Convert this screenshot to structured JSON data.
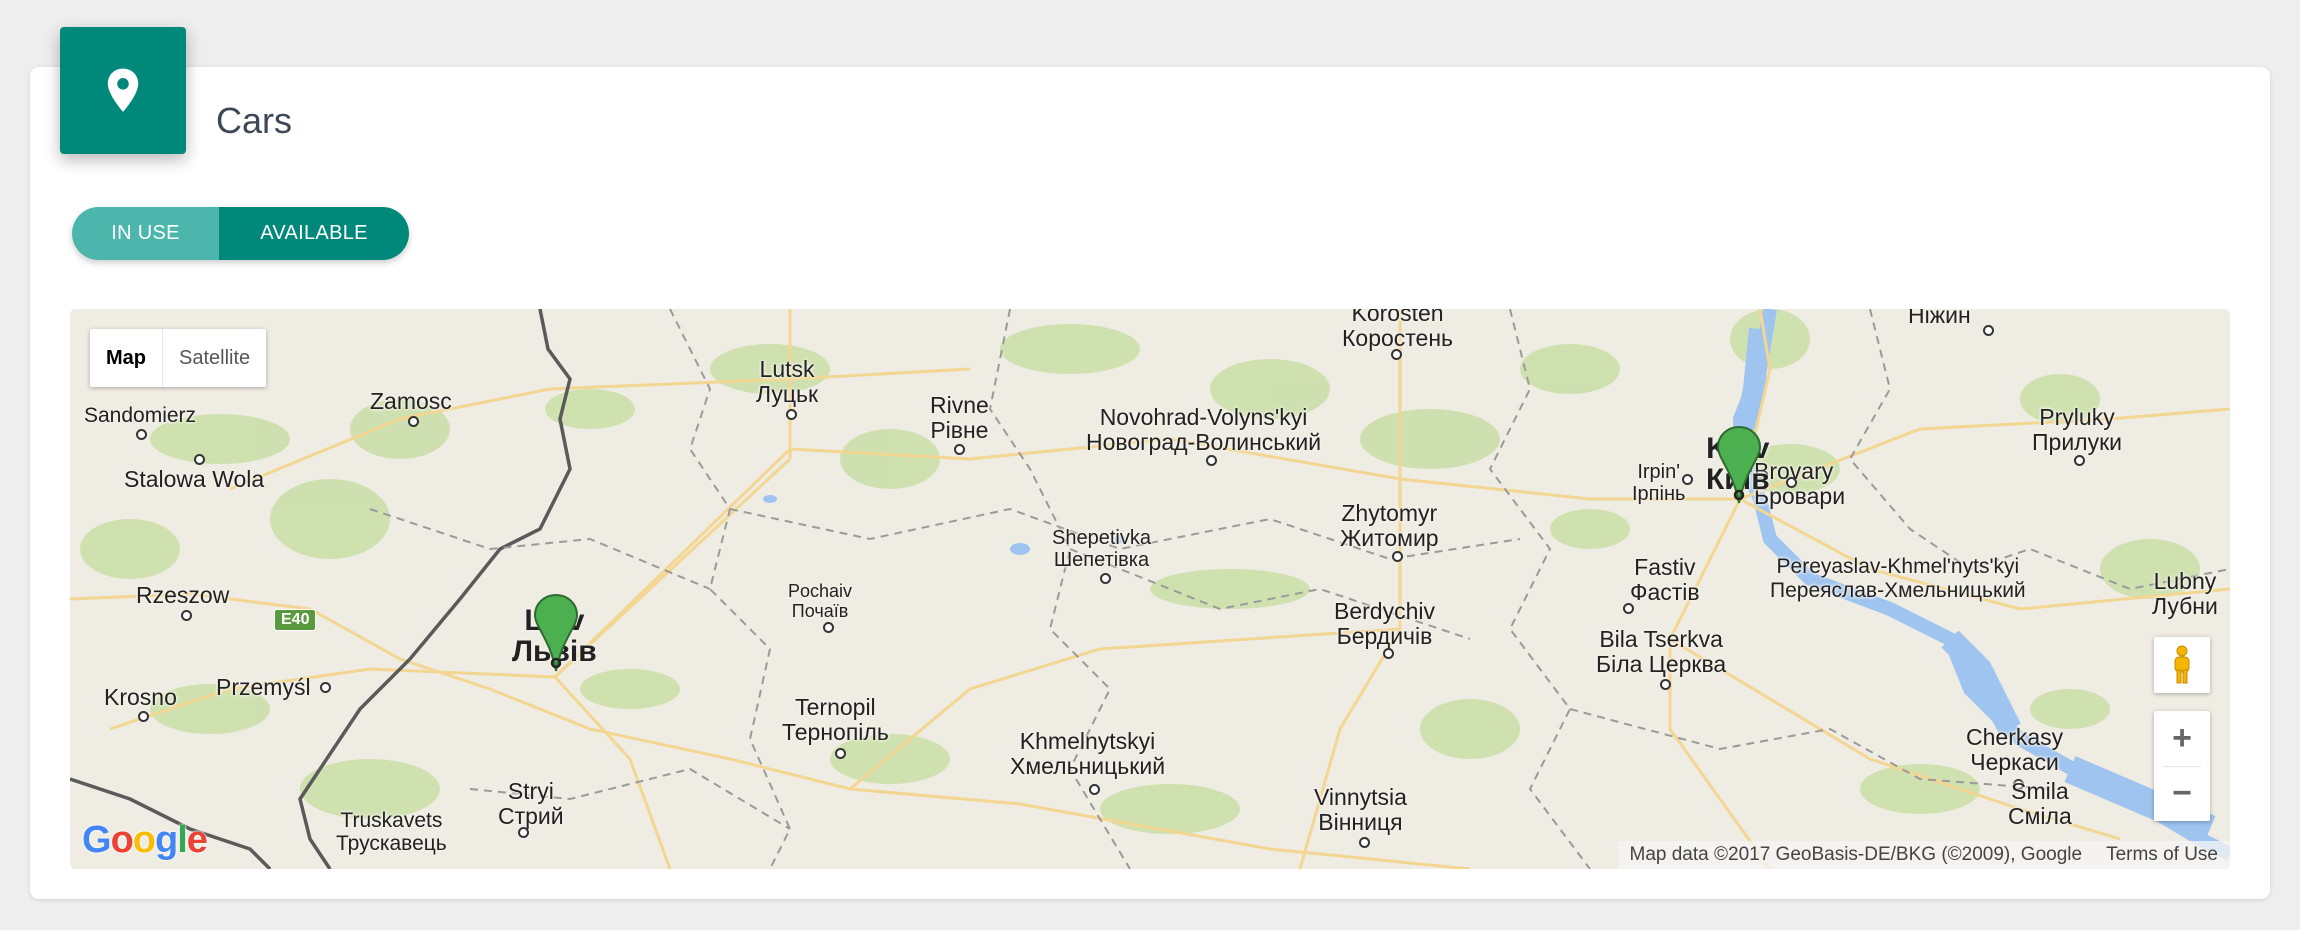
{
  "card": {
    "title": "Cars",
    "icon": "map-pin-icon",
    "accent_color": "#00897b"
  },
  "toggle": {
    "in_use_label": "IN USE",
    "available_label": "AVAILABLE",
    "selected": "AVAILABLE"
  },
  "map": {
    "type_control": {
      "map_label": "Map",
      "satellite_label": "Satellite",
      "active": "Map"
    },
    "places": [
      {
        "line1": "Korosten",
        "line2": "Коростень"
      },
      {
        "line1": "Ніжин",
        "line2": ""
      },
      {
        "line1": "Lutsk",
        "line2": "Луцьк"
      },
      {
        "line1": "Zamosc",
        "line2": ""
      },
      {
        "line1": "Sandomierz",
        "line2": ""
      },
      {
        "line1": "Stalowa Wola",
        "line2": ""
      },
      {
        "line1": "Rivne",
        "line2": "Рівне"
      },
      {
        "line1": "Novohrad-Volyns'kyi",
        "line2": "Новоград-Волинський"
      },
      {
        "line1": "Pryluky",
        "line2": "Прилуки"
      },
      {
        "line1": "Irpin'",
        "line2": "Ірпінь"
      },
      {
        "line1": "Brovary",
        "line2": "Бровари"
      },
      {
        "line1": "Zhytomyr",
        "line2": "Житомир"
      },
      {
        "line1": "Shepetivka",
        "line2": "Шепетівка"
      },
      {
        "line1": "Rzeszow",
        "line2": ""
      },
      {
        "line1": "Pochaiv",
        "line2": "Почаїв"
      },
      {
        "line1": "Fastiv",
        "line2": "Фастів"
      },
      {
        "line1": "Pereyaslav-Khmel'nyts'kyi",
        "line2": "Переяслав-Хмельницький"
      },
      {
        "line1": "Lubny",
        "line2": "Лубни"
      },
      {
        "line1": "Berdychiv",
        "line2": "Бердичів"
      },
      {
        "line1": "Bila Tserkva",
        "line2": "Біла Церква"
      },
      {
        "line1": "Krosno",
        "line2": ""
      },
      {
        "line1": "Przemyśl",
        "line2": ""
      },
      {
        "line1": "Ternopil",
        "line2": "Тернопіль"
      },
      {
        "line1": "Khmelnytskyi",
        "line2": "Хмельницький"
      },
      {
        "line1": "Cherkasy",
        "line2": "Черкаси"
      },
      {
        "line1": "Stryi",
        "line2": "Стрий"
      },
      {
        "line1": "Truskavets",
        "line2": "Трускавець"
      },
      {
        "line1": "Vinnytsia",
        "line2": "Вінниця"
      },
      {
        "line1": "Smila",
        "line2": "Сміла"
      }
    ],
    "major_cities": [
      {
        "line1": "Lviv",
        "line2": "Львів"
      },
      {
        "line1": "Kyiv",
        "line2": "Київ"
      }
    ],
    "road_shield": "E40",
    "markers": [
      {
        "name": "marker-lviv",
        "color": "#4caf50"
      },
      {
        "name": "marker-kyiv",
        "color": "#4caf50"
      }
    ],
    "logo": "Google",
    "attribution": "Map data ©2017 GeoBasis-DE/BKG (©2009), Google",
    "terms_label": "Terms of Use",
    "zoom_in": "+",
    "zoom_out": "−",
    "pegman_icon": "pegman-icon"
  }
}
